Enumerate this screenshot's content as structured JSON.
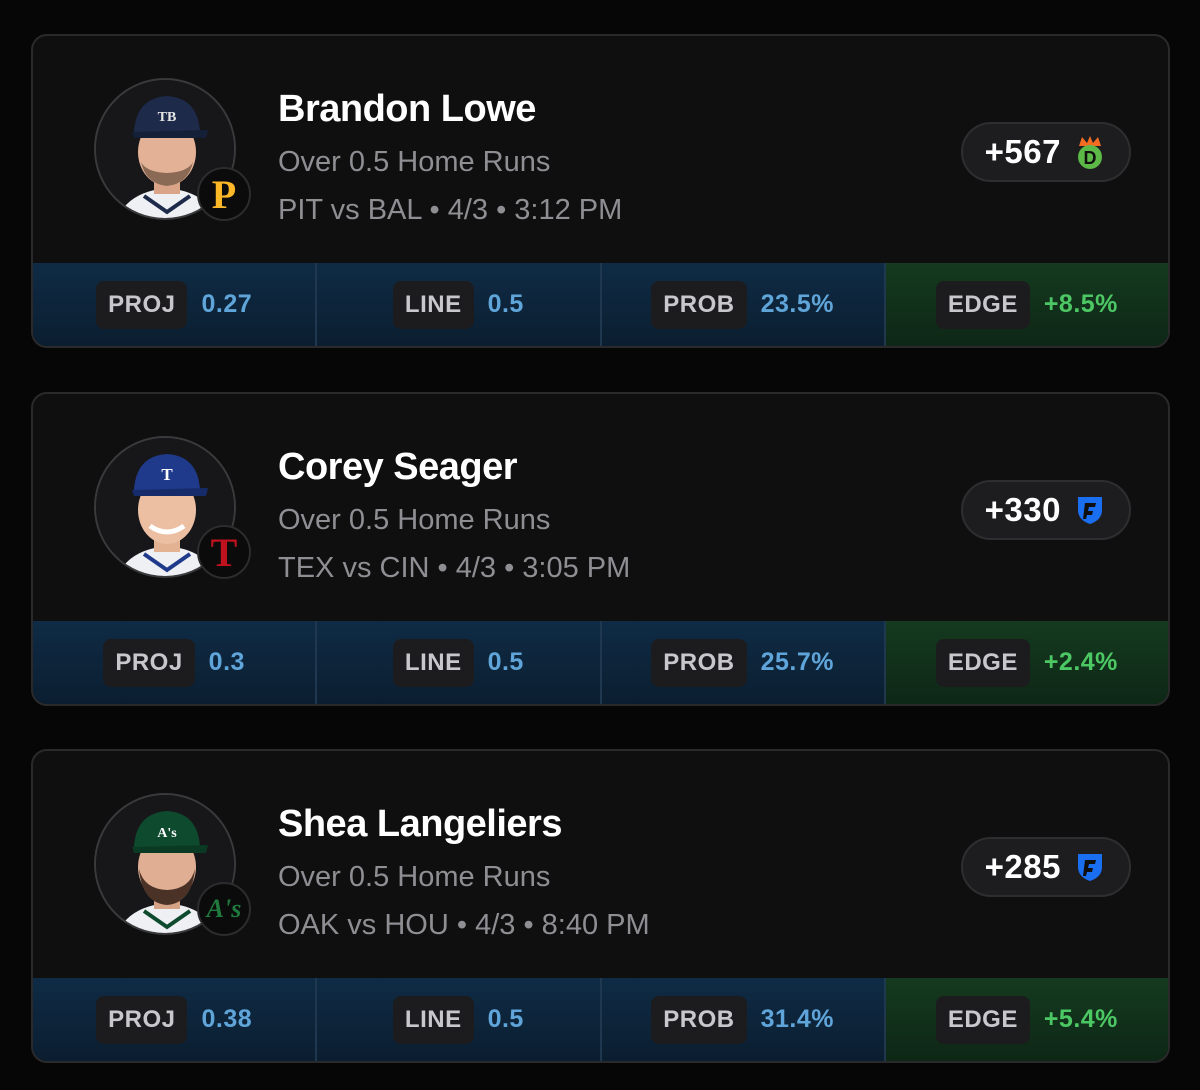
{
  "cards": [
    {
      "name": "Brandon Lowe",
      "prop": "Over 0.5 Home Runs",
      "matchup": "PIT vs BAL  • 4/3 • 3:12 PM",
      "cap_logo": "TB",
      "team_badge": "P",
      "odds": "+567",
      "book_icon": "draftkings-icon",
      "colors": {
        "cap": "#1d2a4a",
        "cap_text": "#e6e6e6",
        "badge": "#fdb827"
      },
      "stats": [
        {
          "label": "PROJ",
          "value": "0.27"
        },
        {
          "label": "LINE",
          "value": "0.5"
        },
        {
          "label": "PROB",
          "value": "23.5%"
        },
        {
          "label": "EDGE",
          "value": "+8.5%"
        }
      ]
    },
    {
      "name": "Corey Seager",
      "prop": "Over 0.5 Home Runs",
      "matchup": "TEX vs CIN  • 4/3 • 3:05 PM",
      "cap_logo": "T",
      "team_badge": "T",
      "odds": "+330",
      "book_icon": "fanduel-icon",
      "colors": {
        "cap": "#1f3a8a",
        "cap_text": "#ffffff",
        "badge": "#c0111f"
      },
      "stats": [
        {
          "label": "PROJ",
          "value": "0.3"
        },
        {
          "label": "LINE",
          "value": "0.5"
        },
        {
          "label": "PROB",
          "value": "25.7%"
        },
        {
          "label": "EDGE",
          "value": "+2.4%"
        }
      ]
    },
    {
      "name": "Shea Langeliers",
      "prop": "Over 0.5 Home Runs",
      "matchup": "OAK vs HOU  • 4/3 • 8:40 PM",
      "cap_logo": "A's",
      "team_badge": "A's",
      "odds": "+285",
      "book_icon": "fanduel-icon",
      "colors": {
        "cap": "#0e4a2e",
        "cap_text": "#ffffff",
        "badge": "#1f7a3e"
      },
      "stats": [
        {
          "label": "PROJ",
          "value": "0.38"
        },
        {
          "label": "LINE",
          "value": "0.5"
        },
        {
          "label": "PROB",
          "value": "31.4%"
        },
        {
          "label": "EDGE",
          "value": "+5.4%"
        }
      ]
    }
  ]
}
